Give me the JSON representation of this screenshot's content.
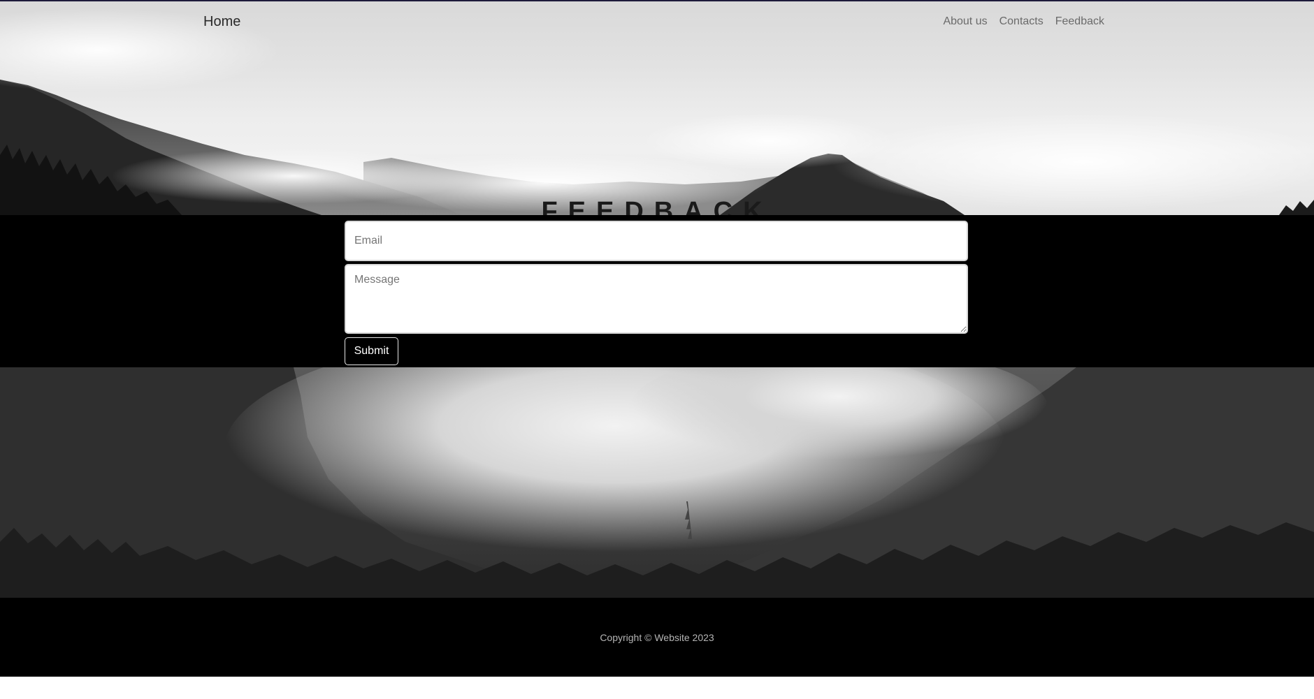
{
  "nav": {
    "brand": "Home",
    "links": [
      "About us",
      "Contacts",
      "Feedback"
    ]
  },
  "hero": {
    "title": "FEEDBACK"
  },
  "form": {
    "email_placeholder": "Email",
    "message_placeholder": "Message",
    "submit_label": "Submit"
  },
  "footer": {
    "copyright": "Copyright © Website 2023"
  },
  "colors": {
    "top_border": "#1d1a3a",
    "band": "#000000",
    "button_border": "#e6e6e6"
  }
}
